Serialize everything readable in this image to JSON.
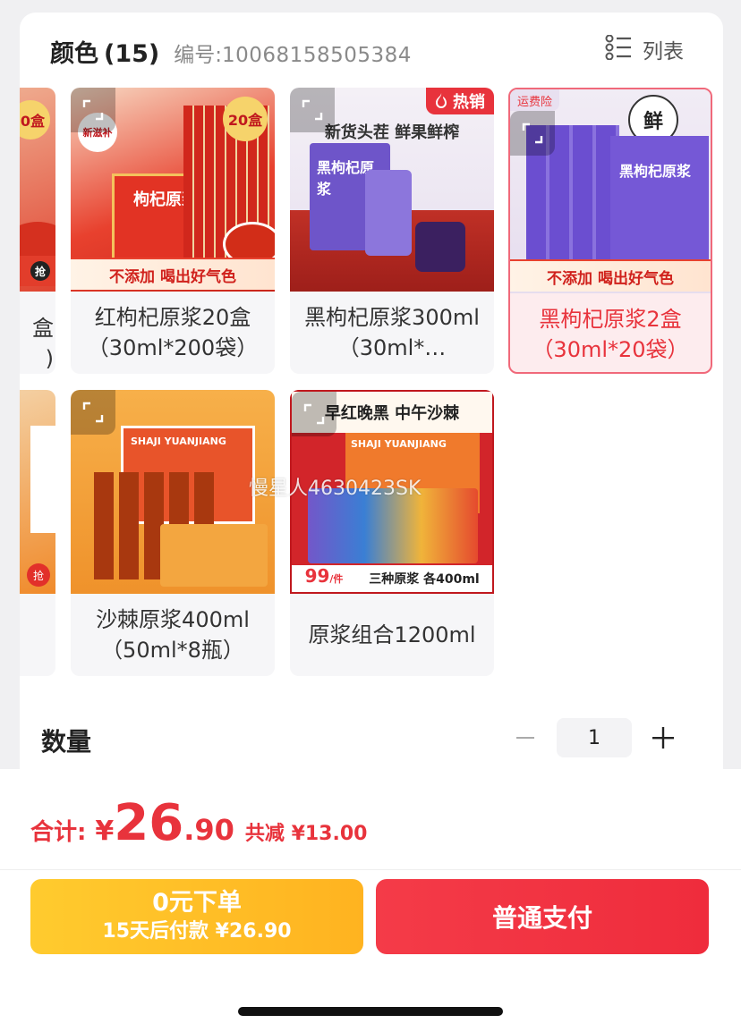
{
  "header": {
    "title": "颜色",
    "count": "(15)",
    "code_label": "编号:",
    "code": "10068158505384",
    "view_toggle_label": "列表"
  },
  "products": [
    {
      "name": "红枸杞原浆20盒（30ml*200袋）",
      "badge": "20盒",
      "ribbon": "不添加 喝出好气色",
      "corner_tag": "新滋补",
      "box_text": "枸杞原浆",
      "selected": false
    },
    {
      "name": "黑枸杞原浆300ml（30ml*…",
      "tagline": "新货头茬 鲜果鲜榨",
      "box_text": "黑枸杞原浆",
      "hot_label": "热销",
      "selected": false
    },
    {
      "name": "黑枸杞原浆2盒（30ml*20袋）",
      "ribbon": "不添加 喝出好气色",
      "corner_tag": "运费险",
      "fresh_seal": "鲜",
      "box_text": "黑枸杞原浆",
      "selected": true
    },
    {
      "name": "沙棘原浆400ml（50ml*8瓶）",
      "box_text": "SHAJI YUANJIANG",
      "selected": false
    },
    {
      "name": "原浆组合1200ml",
      "tagline": "早红晚黑 中午沙棘",
      "box_text": "SHAJI YUANJIANG",
      "price_tag": "99",
      "price_unit": "/件",
      "combo_label": "三种原浆 各400ml",
      "selected": false
    }
  ],
  "partial_left": {
    "badge": "0盒",
    "ribbon_badge": "抢",
    "lines": [
      "盒",
      ")"
    ]
  },
  "watermark": "慢星人4630423SK",
  "quantity": {
    "label": "数量",
    "value": "1",
    "minus": "−",
    "plus": "+"
  },
  "total": {
    "label": "合计:",
    "currency": "¥",
    "integer": "26",
    "decimal": ".90",
    "savings": "共减 ¥13.00"
  },
  "buttons": {
    "pay_later_line1": "0元下单",
    "pay_later_line2": "15天后付款 ¥26.90",
    "pay": "普通支付"
  },
  "colors": {
    "accent_red": "#e8333c",
    "selected_bg": "#fdecee",
    "yellow": "#ffc12a"
  }
}
